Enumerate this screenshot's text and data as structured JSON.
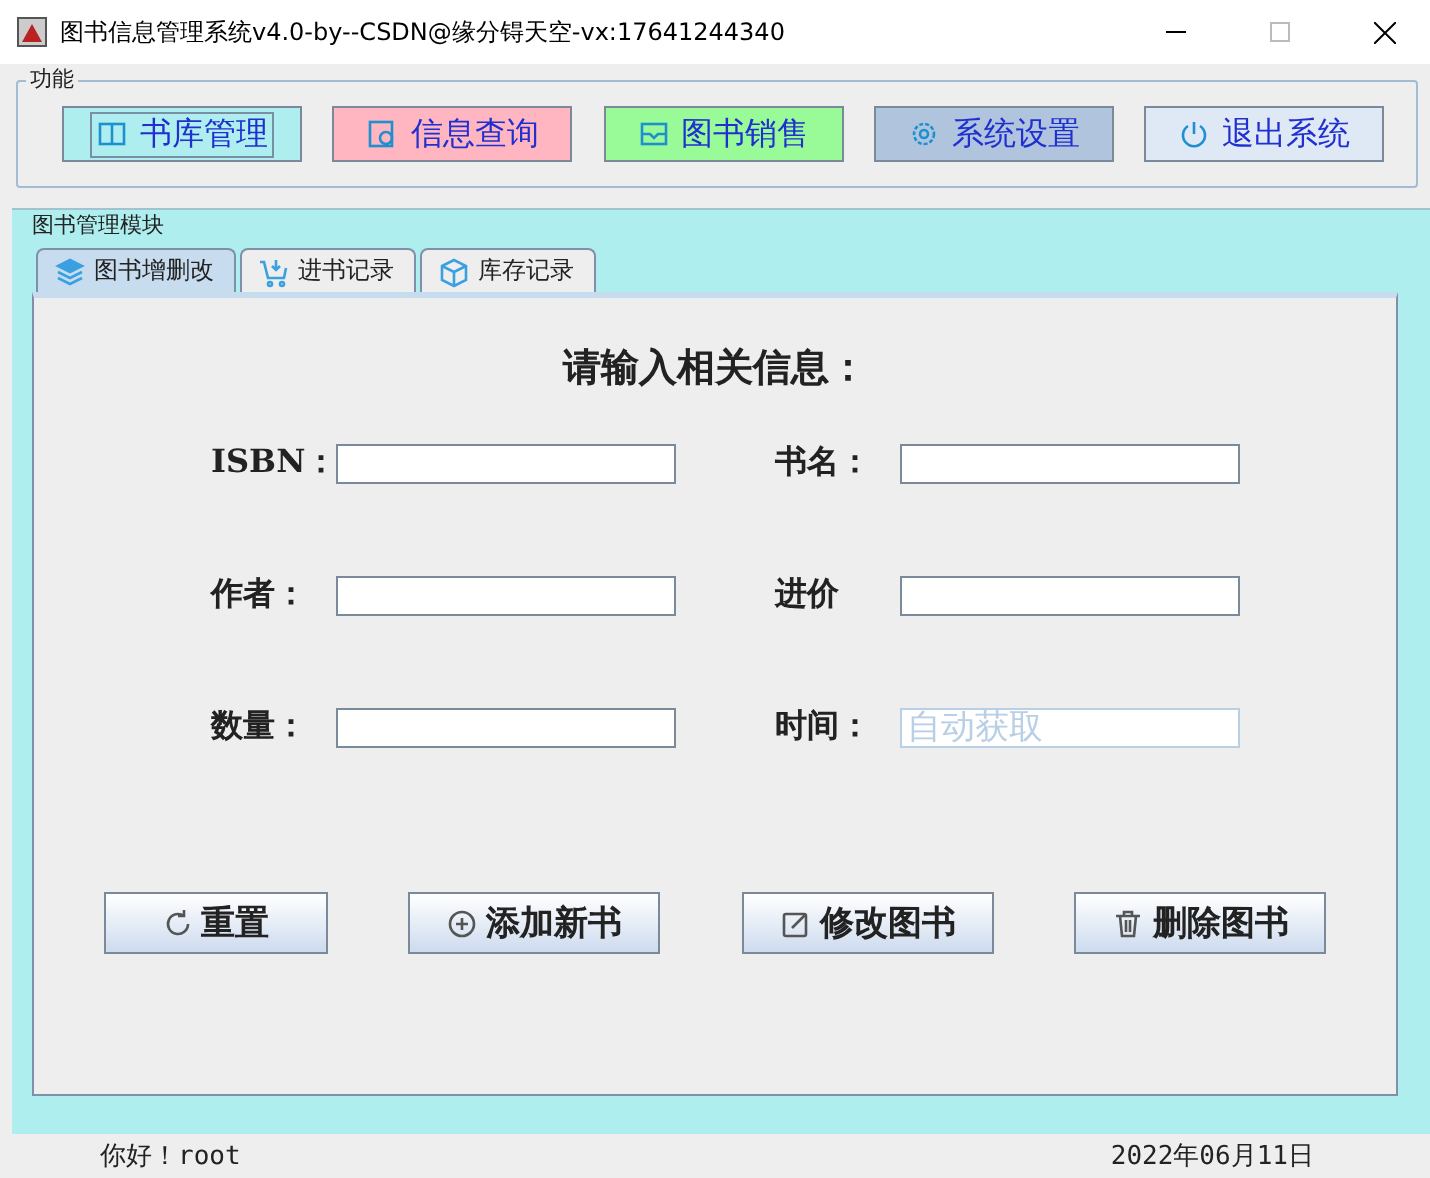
{
  "window": {
    "title": "图书信息管理系统v4.0-by--CSDN@缘分锝天空-vx:17641244340"
  },
  "function_group": {
    "title": "功能",
    "buttons": [
      {
        "label": "书库管理",
        "color": "#afeeee",
        "selected": true,
        "kind": "book"
      },
      {
        "label": "信息查询",
        "color": "#ffb6c1",
        "selected": false,
        "kind": "search"
      },
      {
        "label": "图书销售",
        "color": "#98fb98",
        "selected": false,
        "kind": "tray"
      },
      {
        "label": "系统设置",
        "color": "#b0c4de",
        "selected": false,
        "kind": "gear"
      },
      {
        "label": "退出系统",
        "color": "#dfe8f5",
        "selected": false,
        "kind": "power"
      }
    ]
  },
  "module": {
    "title": "图书管理模块",
    "tabs": [
      {
        "label": "图书增删改",
        "selected": true,
        "kind": "layers"
      },
      {
        "label": "进书记录",
        "selected": false,
        "kind": "cart"
      },
      {
        "label": "库存记录",
        "selected": false,
        "kind": "box"
      }
    ],
    "heading": "请输入相关信息：",
    "fields": [
      {
        "label": "ISBN：",
        "disabled": false
      },
      {
        "label": "书名：",
        "disabled": false
      },
      {
        "label": "作者：",
        "disabled": false
      },
      {
        "label": "进价",
        "disabled": false
      },
      {
        "label": "数量：",
        "disabled": false
      },
      {
        "label": "时间：",
        "value": "自动获取",
        "disabled": true
      }
    ],
    "actions": [
      {
        "label": "重置",
        "kind": "refresh"
      },
      {
        "label": "添加新书",
        "kind": "plus"
      },
      {
        "label": "修改图书",
        "kind": "edit"
      },
      {
        "label": "删除图书",
        "kind": "trash"
      }
    ]
  },
  "status_bar": {
    "greeting": "你好！root",
    "date": "2022年06月11日"
  }
}
